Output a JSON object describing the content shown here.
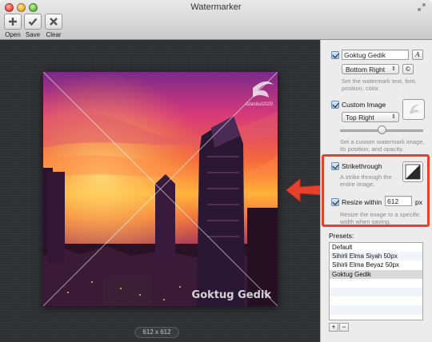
{
  "window": {
    "title": "Watermarker"
  },
  "toolbar": {
    "open_label": "Open",
    "save_label": "Save",
    "clear_label": "Clear"
  },
  "canvas": {
    "image_size": "612 x 612",
    "watermark_text": "Goktug Gedik",
    "logo_text": "istanbul2020"
  },
  "text_watermark": {
    "checked": true,
    "value": "Goktug Gedik",
    "font_button": "A",
    "position": "Bottom Right",
    "copyright_button": "©",
    "help": [
      "Set the watermark text, font,",
      "position, color."
    ]
  },
  "image_watermark": {
    "checked": true,
    "label": "Custom Image",
    "position": "Top Right",
    "opacity": 0.5,
    "help": [
      "Set a custom watermark image,",
      "its position, and opacity."
    ]
  },
  "strikethrough": {
    "checked": true,
    "label": "Strikethrough",
    "help": [
      "A strike through the",
      "entire image."
    ]
  },
  "resize": {
    "checked": true,
    "label": "Resize within",
    "value": "612",
    "unit": "px",
    "help": [
      "Resize the image to a specific",
      "width when saving."
    ]
  },
  "presets": {
    "label": "Presets:",
    "items": [
      "Default",
      "Sihirli Elma Siyah 50px",
      "Sihirli Elma Beyaz 50px",
      "Goktug Gedik"
    ],
    "selected_index": 3,
    "add_label": "+",
    "remove_label": "−"
  },
  "colors": {
    "highlight": "#e8412b",
    "canvas_bg": "#2f3033",
    "panel_bg": "#ececec"
  }
}
